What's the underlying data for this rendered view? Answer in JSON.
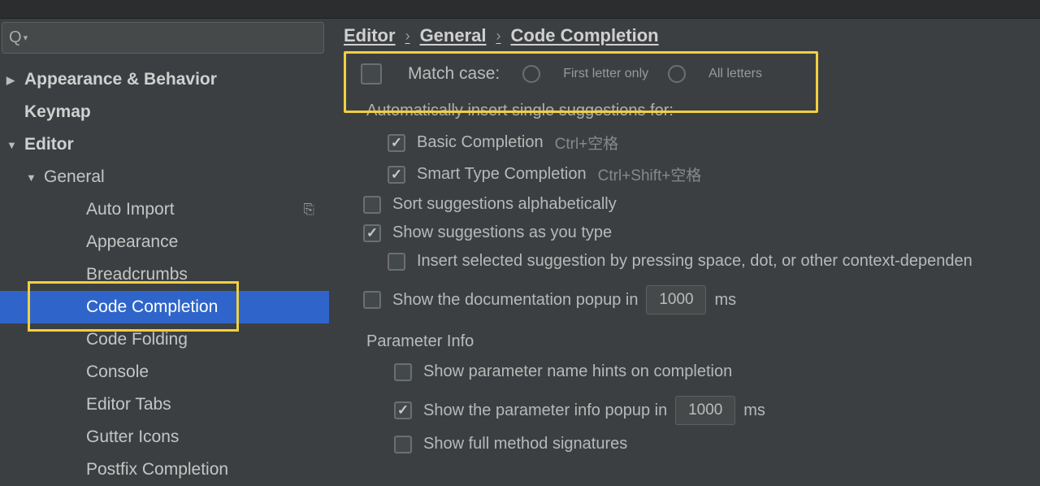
{
  "search": {
    "placeholder": ""
  },
  "sidebar": {
    "items": [
      {
        "label": "Appearance & Behavior",
        "arrow": "right",
        "lv": 0,
        "bold": true
      },
      {
        "label": "Keymap",
        "arrow": "",
        "lv": 0,
        "bold": true
      },
      {
        "label": "Editor",
        "arrow": "down",
        "lv": 0,
        "bold": true
      },
      {
        "label": "General",
        "arrow": "down",
        "lv": 1,
        "bold": false
      },
      {
        "label": "Auto Import",
        "arrow": "",
        "lv": 3,
        "bold": false,
        "proj": true
      },
      {
        "label": "Appearance",
        "arrow": "",
        "lv": 3,
        "bold": false
      },
      {
        "label": "Breadcrumbs",
        "arrow": "",
        "lv": 3,
        "bold": false
      },
      {
        "label": "Code Completion",
        "arrow": "",
        "lv": 3,
        "bold": false,
        "selected": true
      },
      {
        "label": "Code Folding",
        "arrow": "",
        "lv": 3,
        "bold": false
      },
      {
        "label": "Console",
        "arrow": "",
        "lv": 3,
        "bold": false
      },
      {
        "label": "Editor Tabs",
        "arrow": "",
        "lv": 3,
        "bold": false
      },
      {
        "label": "Gutter Icons",
        "arrow": "",
        "lv": 3,
        "bold": false
      },
      {
        "label": "Postfix Completion",
        "arrow": "",
        "lv": 3,
        "bold": false
      }
    ]
  },
  "breadcrumb": {
    "p1": "Editor",
    "p2": "General",
    "p3": "Code Completion"
  },
  "matchCase": {
    "label": "Match case:",
    "opt1": "First letter only",
    "opt2": "All letters"
  },
  "autoInsert": {
    "label": "Automatically insert single suggestions for:"
  },
  "rows": {
    "basic": {
      "label": "Basic Completion",
      "shortcut": "Ctrl+空格"
    },
    "smart": {
      "label": "Smart Type Completion",
      "shortcut": "Ctrl+Shift+空格"
    },
    "sort": {
      "label": "Sort suggestions alphabetically"
    },
    "show": {
      "label": "Show suggestions as you type"
    },
    "insert": {
      "label": "Insert selected suggestion by pressing space, dot, or other context-dependen"
    },
    "doc": {
      "label1": "Show the documentation popup in",
      "value": "1000",
      "label2": "ms"
    }
  },
  "paramInfo": {
    "header": "Parameter Info",
    "hints": {
      "label": "Show parameter name hints on completion"
    },
    "popup": {
      "label1": "Show the parameter info popup in",
      "value": "1000",
      "label2": "ms"
    },
    "full": {
      "label": "Show full method signatures"
    }
  }
}
